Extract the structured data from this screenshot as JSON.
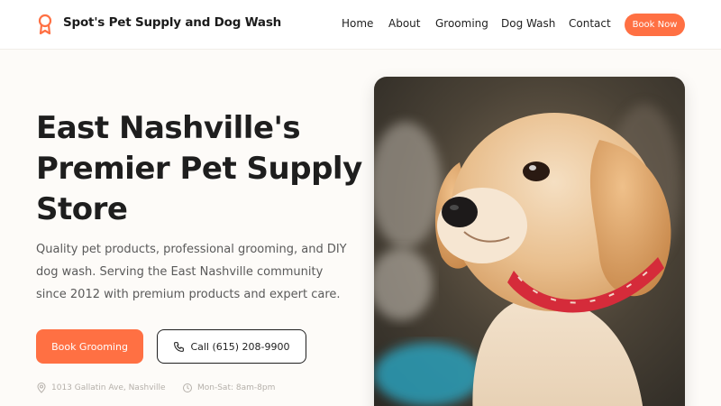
{
  "header": {
    "brand": "Spot's Pet Supply and Dog Wash",
    "logo_icon": "award-ribbon-icon",
    "nav": [
      "Home",
      "About",
      "Grooming",
      "Dog Wash",
      "Contact"
    ],
    "cta_label": "Book Now"
  },
  "hero": {
    "title": "East Nashville's Premier Pet Supply Store",
    "description": "Quality pet products, professional grooming, and DIY dog wash. Serving the East Nashville community since 2012 with premium products and expert care.",
    "primary_button": "Book Grooming",
    "secondary_button": "Call (615) 208-9900",
    "phone_icon": "phone-icon",
    "address": "1013 Gallatin Ave, Nashville",
    "address_icon": "map-pin-icon",
    "hours": "Mon-Sat: 8am-8pm",
    "hours_icon": "clock-icon",
    "image_subject": "golden retriever puppy with red collar"
  },
  "colors": {
    "accent": "#ff7043",
    "text": "#1e1e1e",
    "muted": "#5a5a5a",
    "background": "#fdfbf8"
  }
}
